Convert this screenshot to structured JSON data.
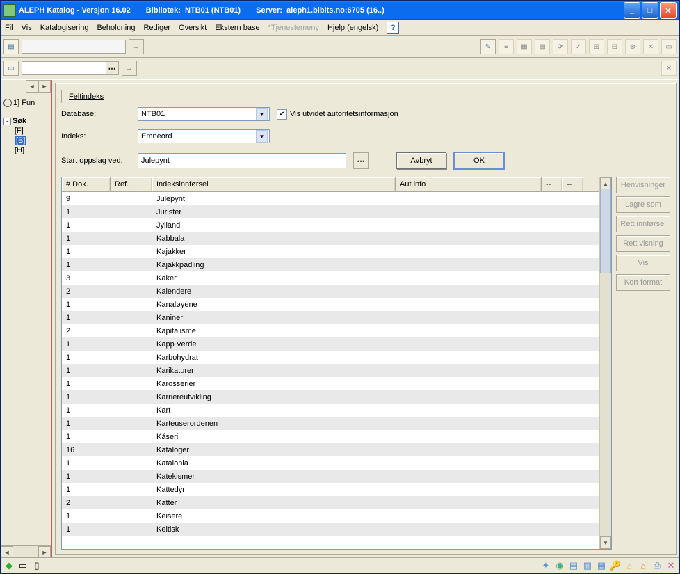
{
  "title": {
    "app": "ALEPH Katalog - Versjon 16.02",
    "lib_l": "Bibliotek:",
    "lib_v": "NTB01 (NTB01)",
    "srv_l": "Server:",
    "srv_v": "aleph1.bibits.no:6705 (16..)"
  },
  "menu": {
    "fil": "Fil",
    "vis": "Vis",
    "kat": "Katalogisering",
    "beh": "Beholdning",
    "red": "Rediger",
    "ove": "Oversikt",
    "eks": "Ekstern base",
    "tje": "*Tjenestemeny",
    "hje": "Hjelp (engelsk)",
    "help_icon": "?"
  },
  "tree": {
    "fun": "1] Fun",
    "sok": "Søk",
    "f": "[F]",
    "b": "[B]",
    "h": "[H]"
  },
  "tab": {
    "felt": "Feltindeks"
  },
  "form": {
    "db_l": "Database:",
    "db_v": "NTB01",
    "idx_l": "Indeks:",
    "idx_v": "Emneord",
    "start_l": "Start oppslag ved:",
    "start_v": "Julepynt",
    "chk_l": "Vis utvidet autoritetsinformasjon",
    "avbryt": "Avbryt",
    "ok": "OK"
  },
  "cols": {
    "dok": "# Dok.",
    "ref": "Ref.",
    "idx": "Indeksinnførsel",
    "aut": "Aut.info",
    "d1": "--",
    "d2": "--"
  },
  "rows": [
    {
      "d": "9",
      "i": "Julepynt"
    },
    {
      "d": "1",
      "i": "Jurister"
    },
    {
      "d": "1",
      "i": "Jylland"
    },
    {
      "d": "1",
      "i": "Kabbala"
    },
    {
      "d": "1",
      "i": "Kajakker"
    },
    {
      "d": "1",
      "i": "Kajakkpadling"
    },
    {
      "d": "3",
      "i": "Kaker"
    },
    {
      "d": "2",
      "i": "Kalendere"
    },
    {
      "d": "1",
      "i": "Kanaløyene"
    },
    {
      "d": "1",
      "i": "Kaniner"
    },
    {
      "d": "2",
      "i": "Kapitalisme"
    },
    {
      "d": "1",
      "i": "Kapp Verde"
    },
    {
      "d": "1",
      "i": "Karbohydrat"
    },
    {
      "d": "1",
      "i": "Karikaturer"
    },
    {
      "d": "1",
      "i": "Karosserier"
    },
    {
      "d": "1",
      "i": "Karriereutvikling"
    },
    {
      "d": "1",
      "i": "Kart"
    },
    {
      "d": "1",
      "i": "Karteuserordenen"
    },
    {
      "d": "1",
      "i": "Kåseri"
    },
    {
      "d": "16",
      "i": "Kataloger"
    },
    {
      "d": "1",
      "i": "Katalonia"
    },
    {
      "d": "1",
      "i": "Katekismer"
    },
    {
      "d": "1",
      "i": "Kattedyr"
    },
    {
      "d": "2",
      "i": "Katter"
    },
    {
      "d": "1",
      "i": "Keisere"
    },
    {
      "d": "1",
      "i": "Keltisk"
    }
  ],
  "side": {
    "hen": "Henvisninger",
    "lag": "Lagre som",
    "rein": "Rett innførsel",
    "revis": "Rett visning",
    "vis": "Vis",
    "kort": "Kort format"
  },
  "win": {
    "min": "_",
    "max": "□",
    "cls": "✕"
  }
}
